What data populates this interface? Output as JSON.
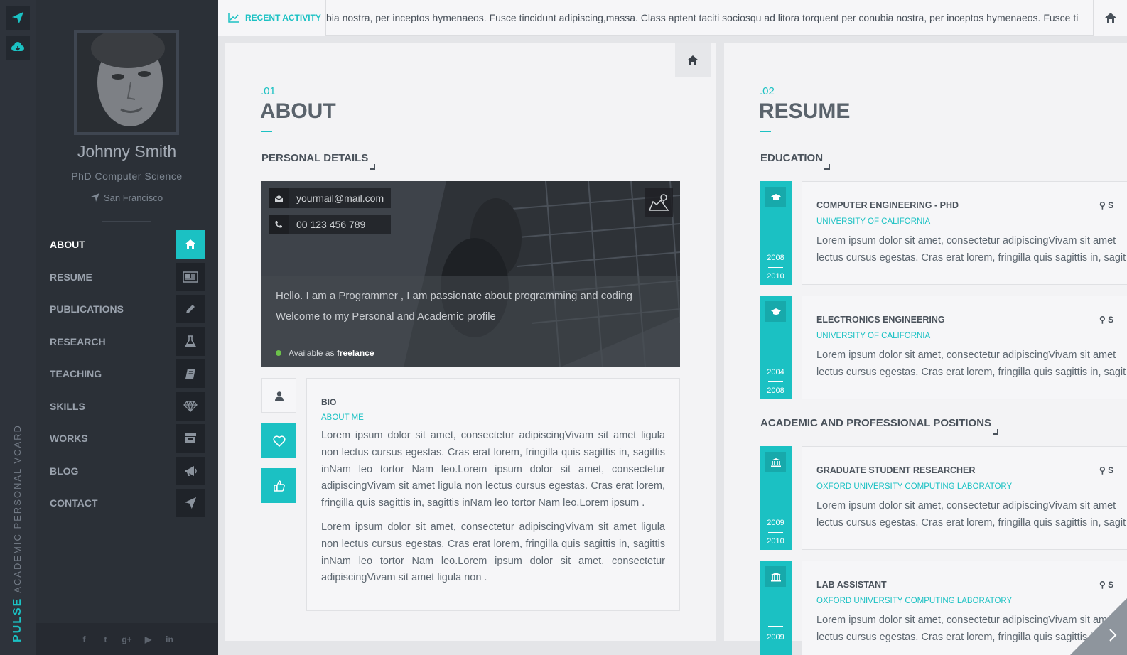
{
  "brand": {
    "word1": "PULSE",
    "word2": "ACADEMIC PERSONAL VCARD"
  },
  "colors": {
    "accent": "#1bc1c3",
    "sidebar": "#2b3037",
    "rail": "#2e333b"
  },
  "profile": {
    "name": "Johnny Smith",
    "title": "PhD Computer Science",
    "location": "San Francisco"
  },
  "nav": [
    {
      "label": "ABOUT",
      "icon": "home-icon",
      "active": true
    },
    {
      "label": "RESUME",
      "icon": "newspaper-icon"
    },
    {
      "label": "PUBLICATIONS",
      "icon": "pencil-icon"
    },
    {
      "label": "RESEARCH",
      "icon": "flask-icon"
    },
    {
      "label": "TEACHING",
      "icon": "book-icon"
    },
    {
      "label": "SKILLS",
      "icon": "diamond-icon"
    },
    {
      "label": "WORKS",
      "icon": "archive-icon"
    },
    {
      "label": "BLOG",
      "icon": "megaphone-icon"
    },
    {
      "label": "CONTACT",
      "icon": "paper-plane-icon"
    }
  ],
  "social": [
    {
      "icon": "facebook-icon",
      "glyph": "f"
    },
    {
      "icon": "twitter-icon",
      "glyph": "t"
    },
    {
      "icon": "google-plus-icon",
      "glyph": "g+"
    },
    {
      "icon": "youtube-icon",
      "glyph": "▶"
    },
    {
      "icon": "linkedin-icon",
      "glyph": "in"
    }
  ],
  "topbar": {
    "recent_label": "RECENT ACTIVITY",
    "ticker": "bia nostra, per inceptos hymenaeos. Fusce tincidunt adipiscing,massa. Class aptent taciti sociosqu ad litora torquent per conubia nostra, per inceptos hymenaeos. Fusce tincidunt adipiscing,massa."
  },
  "about": {
    "num": ".01",
    "title": "ABOUT",
    "personal_heading": "PERSONAL DETAILS",
    "email": "yourmail@mail.com",
    "phone": "00 123 456 789",
    "hello": "Hello. I am a Programmer , I am passionate about programming and coding",
    "welcome": "Welcome to my Personal and Academic profile",
    "available_prefix": "Available as ",
    "available_value": "freelance",
    "bio_title": "BIO",
    "bio_sub": "ABOUT ME",
    "bio_p1": "Lorem ipsum dolor sit amet, consectetur adipiscingVivam sit amet ligula non lectus cursus egestas. Cras erat lorem, fringilla quis sagittis in, sagittis inNam leo tortor Nam leo.Lorem ipsum dolor sit amet, consectetur adipiscingVivam sit amet ligula non lectus cursus egestas. Cras erat lorem, fringilla quis sagittis in, sagittis inNam leo tortor Nam leo.Lorem ipsum .",
    "bio_p2": "Lorem ipsum dolor sit amet, consectetur adipiscingVivam sit amet ligula non lectus cursus egestas. Cras erat lorem, fringilla quis sagittis in, sagittis inNam leo tortor Nam leo.Lorem ipsum dolor sit amet, consectetur adipiscingVivam sit amet ligula non ."
  },
  "resume": {
    "num": ".02",
    "title": "RESUME",
    "education_heading": "EDUCATION",
    "positions_heading": "ACADEMIC AND PROFESSIONAL POSITIONS",
    "location_short": "S",
    "education": [
      {
        "title": "COMPUTER ENGINEERING - PHD",
        "org": "UNIVERSITY OF CALIFORNIA",
        "from": "2008",
        "to": "2010",
        "text1": "Lorem ipsum dolor sit amet, consectetur adipiscingVivam sit amet",
        "text2": "lectus cursus egestas. Cras erat lorem, fringilla quis sagittis in, sagit"
      },
      {
        "title": "ELECTRONICS ENGINEERING",
        "org": "UNIVERSITY OF CALIFORNIA",
        "from": "2004",
        "to": "2008",
        "text1": "Lorem ipsum dolor sit amet, consectetur adipiscingVivam sit amet",
        "text2": "lectus cursus egestas. Cras erat lorem, fringilla quis sagittis in, sagit"
      }
    ],
    "positions": [
      {
        "title": "GRADUATE STUDENT RESEARCHER",
        "org": "OXFORD UNIVERSITY COMPUTING LABORATORY",
        "from": "2009",
        "to": "2010",
        "text1": "Lorem ipsum dolor sit amet, consectetur adipiscingVivam sit amet",
        "text2": "lectus cursus egestas. Cras erat lorem, fringilla quis sagittis in, sagit"
      },
      {
        "title": "LAB ASSISTANT",
        "org": "OXFORD UNIVERSITY COMPUTING LABORATORY",
        "from": "2009",
        "to": "",
        "text1": "Lorem ipsum dolor sit amet, consectetur adipiscingVivam sit amet",
        "text2": "lectus cursus egestas. Cras erat lorem, fringilla quis sagittis in, sagit"
      }
    ]
  }
}
